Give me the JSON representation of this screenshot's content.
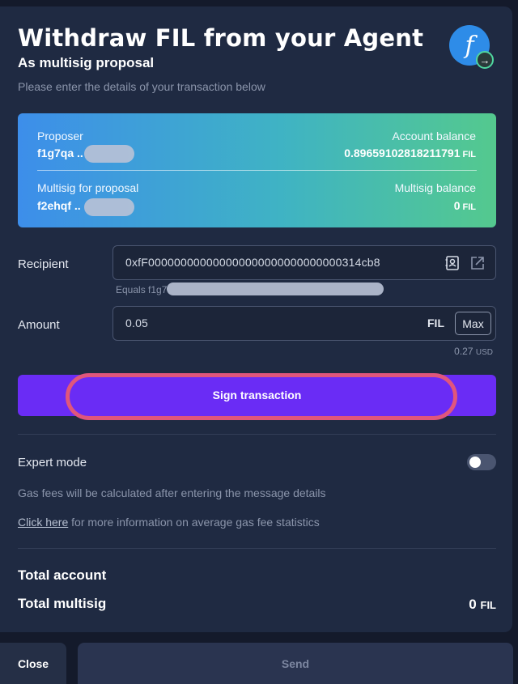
{
  "header": {
    "title": "Withdraw FIL from your Agent",
    "subtitle": "As multisig proposal",
    "description": "Please enter the details of your transaction below",
    "logo_glyph": "f",
    "badge_glyph": "→"
  },
  "summary": {
    "proposer_label": "Proposer",
    "proposer_value": "f1g7qa ..",
    "account_balance_label": "Account balance",
    "account_balance_value": "0.89659102818211791",
    "account_balance_unit": "FIL",
    "multisig_label": "Multisig for proposal",
    "multisig_value": "f2ehqf ..",
    "multisig_balance_label": "Multisig balance",
    "multisig_balance_value": "0",
    "multisig_balance_unit": "FIL"
  },
  "recipient": {
    "label": "Recipient",
    "value": "0xfF000000000000000000000000000000314cb8",
    "equals": "Equals f1g7"
  },
  "amount": {
    "label": "Amount",
    "value": "0.05",
    "unit": "FIL",
    "max_label": "Max",
    "usd_value": "0.27",
    "usd_unit": "USD"
  },
  "sign_button": "Sign transaction",
  "expert_mode": {
    "label": "Expert mode",
    "enabled": false
  },
  "gas_text": "Gas fees will be calculated after entering the message details",
  "info": {
    "link": "Click here",
    "rest": " for more information on average gas fee statistics"
  },
  "totals": {
    "account_label": "Total account",
    "multisig_label": "Total multisig",
    "multisig_value": "0",
    "multisig_unit": "FIL"
  },
  "footer": {
    "close": "Close",
    "send": "Send"
  },
  "colors": {
    "accent": "#6a2cf5",
    "highlight_ring": "#e0567c",
    "panel": "#1f2a42"
  }
}
